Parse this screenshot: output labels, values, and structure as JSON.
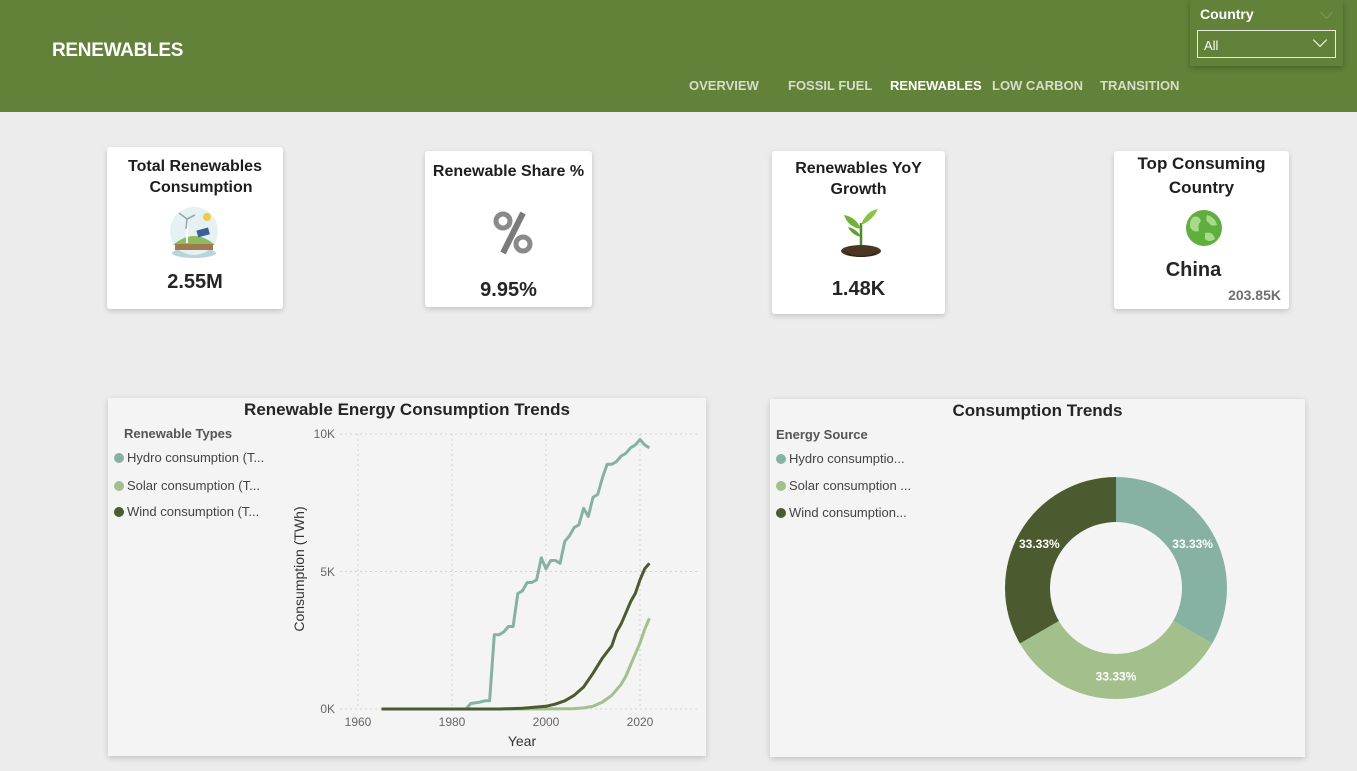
{
  "header": {
    "title": "RENEWABLES",
    "nav": [
      "OVERVIEW",
      "FOSSIL FUEL",
      "RENEWABLES",
      "LOW CARBON",
      "TRANSITION"
    ],
    "active_nav": "RENEWABLES"
  },
  "slicer": {
    "label": "Country",
    "value": "All"
  },
  "kpis": {
    "total": {
      "title_line1": "Total Renewables",
      "title_line2": "Consumption",
      "value": "2.55M",
      "icon": "renewable-landscape-icon"
    },
    "share": {
      "title": "Renewable Share %",
      "value": "9.95%",
      "icon": "percent-icon"
    },
    "yoy": {
      "title_line1": "Renewables YoY",
      "title_line2": "Growth",
      "value": "1.48K",
      "icon": "sprout-icon"
    },
    "top": {
      "title_line1": "Top Consuming",
      "title_line2": "Country",
      "value": "China",
      "sub": "203.85K",
      "icon": "globe-icon"
    }
  },
  "colors": {
    "header": "#628139",
    "hydro": "#87b2a3",
    "solar": "#a2bf8c",
    "wind": "#4c5b2f"
  },
  "line_chart": {
    "title": "Renewable Energy Consumption Trends",
    "legend_title": "Renewable Types",
    "legend": [
      "Hydro consumption (T...",
      "Solar consumption (T...",
      "Wind consumption (T..."
    ],
    "xlabel": "Year",
    "ylabel": "Consumption (TWh)",
    "y_ticks": [
      "10K",
      "5K",
      "0K"
    ],
    "x_ticks": [
      "1960",
      "1980",
      "2000",
      "2020"
    ]
  },
  "donut_chart": {
    "title": "Consumption Trends",
    "legend_title": "Energy Source",
    "legend": [
      "Hydro consumptio...",
      "Solar consumption ...",
      "Wind consumption..."
    ],
    "labels": [
      "33.33%",
      "33.33%",
      "33.33%"
    ]
  },
  "chart_data": [
    {
      "type": "line",
      "title": "Renewable Energy Consumption Trends",
      "xlabel": "Year",
      "ylabel": "Consumption (TWh)",
      "xlim": [
        1955,
        2032
      ],
      "ylim": [
        0,
        10000
      ],
      "grid": true,
      "legend_position": "left",
      "series": [
        {
          "name": "Hydro consumption (T...",
          "color": "#87b2a3",
          "points": [
            [
              1965,
              0
            ],
            [
              1983,
              0
            ],
            [
              1984,
              200
            ],
            [
              1986,
              250
            ],
            [
              1987,
              300
            ],
            [
              1988,
              300
            ],
            [
              1989,
              2700
            ],
            [
              1990,
              2700
            ],
            [
              1991,
              2800
            ],
            [
              1992,
              3000
            ],
            [
              1993,
              3000
            ],
            [
              1994,
              4200
            ],
            [
              1995,
              4300
            ],
            [
              1996,
              4600
            ],
            [
              1997,
              4600
            ],
            [
              1998,
              4700
            ],
            [
              1999,
              5500
            ],
            [
              2000,
              5100
            ],
            [
              2001,
              5400
            ],
            [
              2002,
              5400
            ],
            [
              2003,
              5300
            ],
            [
              2004,
              6100
            ],
            [
              2005,
              6300
            ],
            [
              2006,
              6600
            ],
            [
              2007,
              6700
            ],
            [
              2008,
              7300
            ],
            [
              2009,
              7000
            ],
            [
              2010,
              7700
            ],
            [
              2011,
              7800
            ],
            [
              2012,
              8400
            ],
            [
              2013,
              8900
            ],
            [
              2014,
              8900
            ],
            [
              2015,
              9000
            ],
            [
              2016,
              9200
            ],
            [
              2017,
              9300
            ],
            [
              2018,
              9500
            ],
            [
              2019,
              9600
            ],
            [
              2020,
              9800
            ],
            [
              2021,
              9600
            ],
            [
              2022,
              9500
            ]
          ]
        },
        {
          "name": "Solar consumption (T...",
          "color": "#a2bf8c",
          "points": [
            [
              1965,
              0
            ],
            [
              1995,
              0
            ],
            [
              2000,
              5
            ],
            [
              2004,
              10
            ],
            [
              2006,
              15
            ],
            [
              2008,
              40
            ],
            [
              2010,
              100
            ],
            [
              2012,
              250
            ],
            [
              2014,
              500
            ],
            [
              2016,
              900
            ],
            [
              2017,
              1200
            ],
            [
              2018,
              1600
            ],
            [
              2019,
              2000
            ],
            [
              2020,
              2400
            ],
            [
              2021,
              2900
            ],
            [
              2022,
              3300
            ]
          ]
        },
        {
          "name": "Wind consumption (T...",
          "color": "#4c5b2f",
          "points": [
            [
              1965,
              0
            ],
            [
              1990,
              0
            ],
            [
              1995,
              30
            ],
            [
              2000,
              100
            ],
            [
              2002,
              180
            ],
            [
              2004,
              300
            ],
            [
              2006,
              500
            ],
            [
              2008,
              800
            ],
            [
              2010,
              1300
            ],
            [
              2012,
              1850
            ],
            [
              2014,
              2300
            ],
            [
              2015,
              2800
            ],
            [
              2016,
              3100
            ],
            [
              2017,
              3500
            ],
            [
              2018,
              3900
            ],
            [
              2019,
              4200
            ],
            [
              2020,
              4700
            ],
            [
              2021,
              5100
            ],
            [
              2022,
              5300
            ]
          ]
        }
      ]
    },
    {
      "type": "pie",
      "title": "Consumption Trends",
      "legend_position": "left",
      "categories": [
        "Hydro consumptio...",
        "Solar consumption ...",
        "Wind consumption..."
      ],
      "values": [
        33.33,
        33.33,
        33.33
      ],
      "labels": [
        "33.33%",
        "33.33%",
        "33.33%"
      ],
      "colors": [
        "#87b2a3",
        "#a2bf8c",
        "#4c5b2f"
      ]
    }
  ]
}
